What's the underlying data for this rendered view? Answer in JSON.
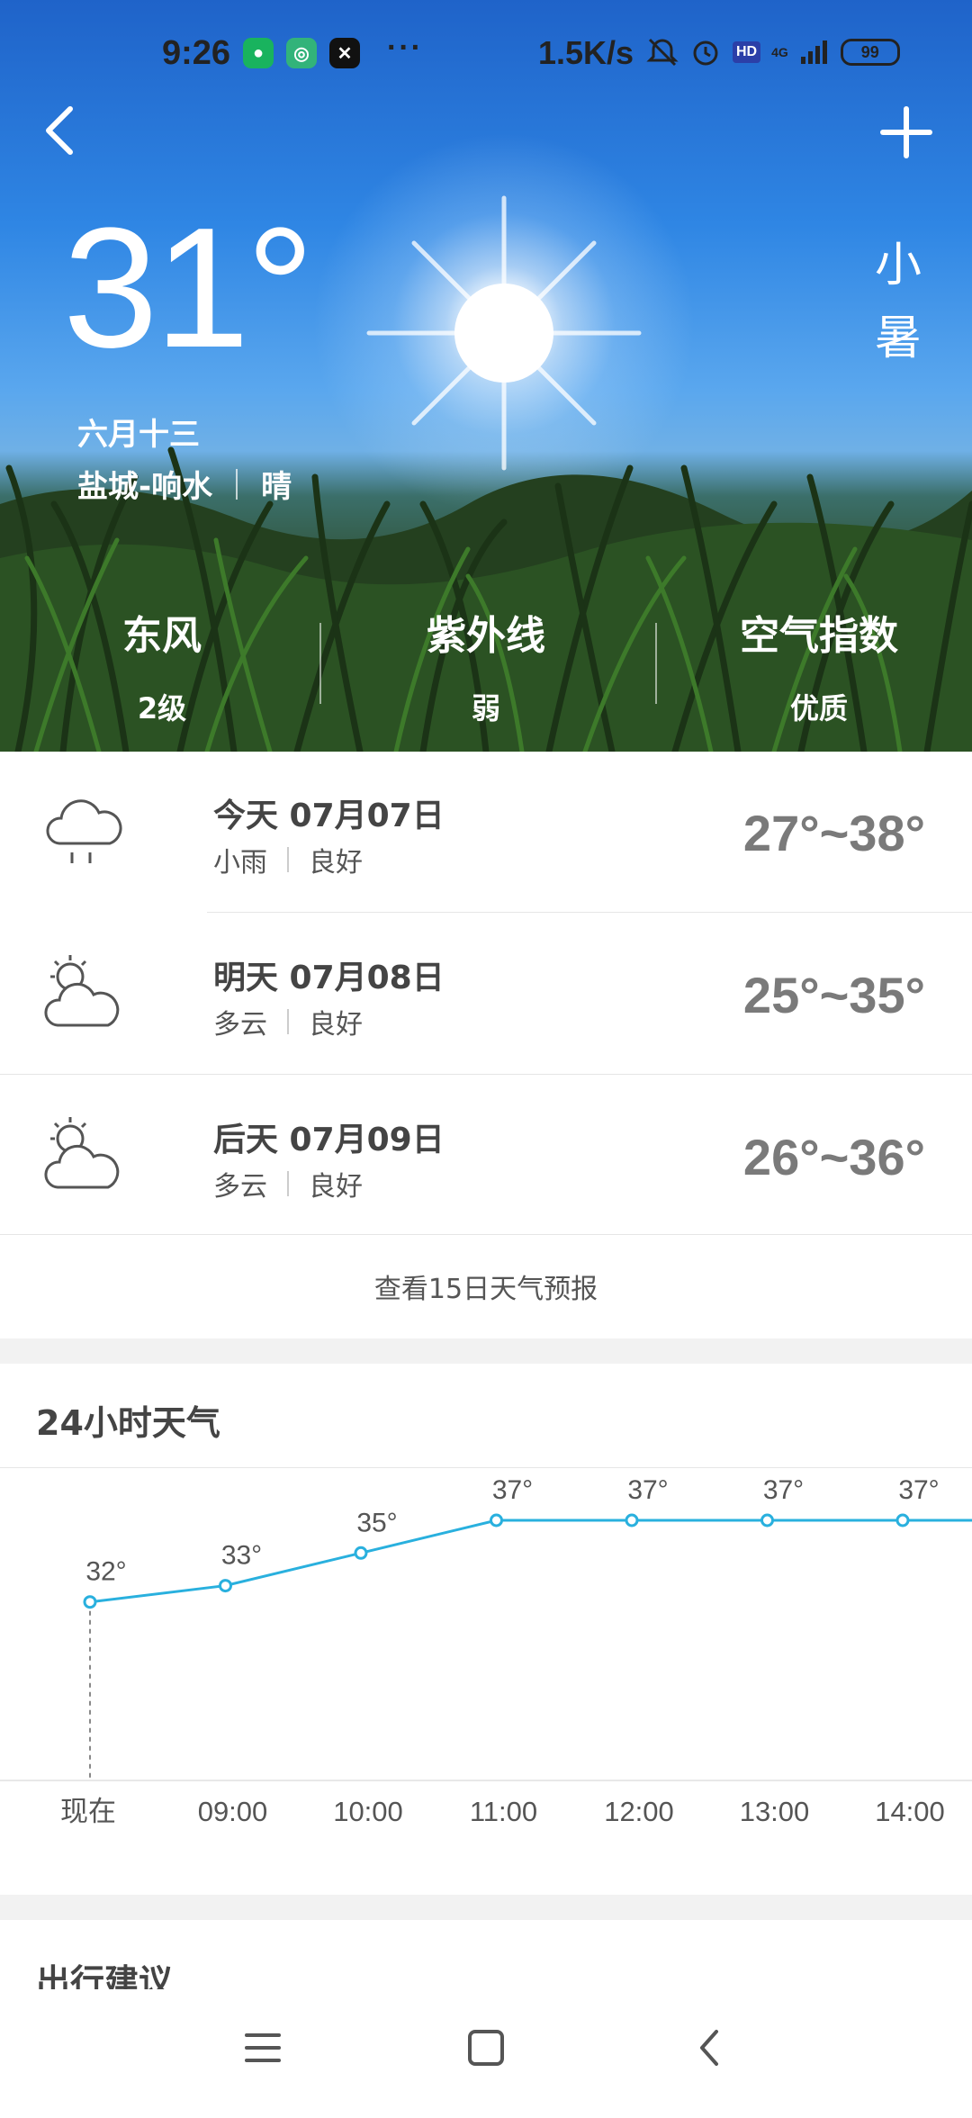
{
  "status_bar": {
    "time": "9:26",
    "more": "···",
    "net_speed": "1.5K/s",
    "signal": "4G",
    "battery": "99",
    "icons": [
      "mute-icon",
      "alarm-icon",
      "hd-icon",
      "signal-icon",
      "battery-icon"
    ]
  },
  "header": {
    "back_icon": "chevron-left-icon",
    "add_icon": "plus-icon"
  },
  "current": {
    "temperature": "31°",
    "lunar_date": "六月十三",
    "location": "盐城-响水",
    "condition": "晴",
    "solar_term": [
      "小",
      "暑"
    ]
  },
  "indices": [
    {
      "title": "东风",
      "value": "2级"
    },
    {
      "title": "紫外线",
      "value": "弱"
    },
    {
      "title": "空气指数",
      "value": "优质"
    }
  ],
  "forecast": {
    "days": [
      {
        "date": "今天 07月07日",
        "weather": "小雨",
        "air": "良好",
        "range": "27°~38°",
        "icon": "rain-cloud-icon"
      },
      {
        "date": "明天 07月08日",
        "weather": "多云",
        "air": "良好",
        "range": "25°~35°",
        "icon": "partly-cloudy-icon"
      },
      {
        "date": "后天 07月09日",
        "weather": "多云",
        "air": "良好",
        "range": "26°~36°",
        "icon": "partly-cloudy-icon"
      }
    ],
    "more_link": "查看15日天气预报"
  },
  "hourly": {
    "title": "24小时天气",
    "chart_data": {
      "type": "line",
      "title": "24小时天气",
      "x": [
        "现在",
        "09:00",
        "10:00",
        "11:00",
        "12:00",
        "13:00",
        "14:00"
      ],
      "series": [
        {
          "values": [
            32,
            33,
            35,
            37,
            37,
            37,
            37
          ]
        }
      ],
      "labels": [
        "32°",
        "33°",
        "35°",
        "37°",
        "37°",
        "37°",
        "37°"
      ],
      "color": "#29b0de"
    }
  },
  "travel": {
    "title": "出行建议"
  },
  "nav": {
    "icons": [
      "menu-icon",
      "home-icon",
      "back-icon"
    ]
  }
}
